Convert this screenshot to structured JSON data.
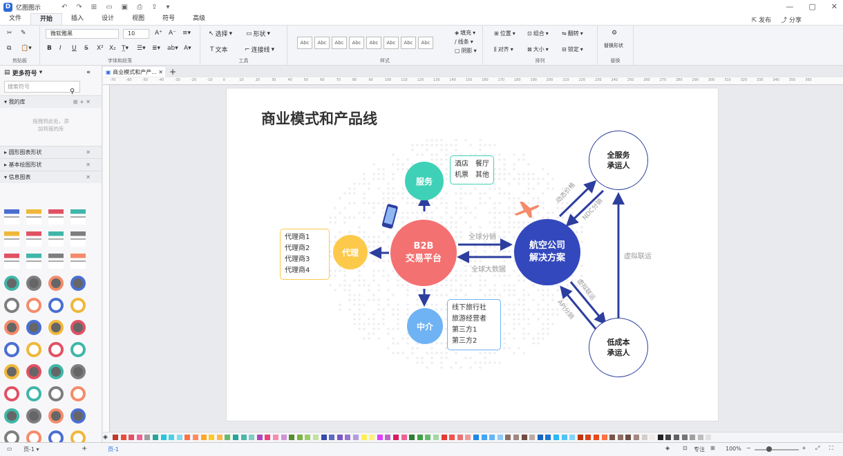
{
  "app": {
    "title": "亿图图示"
  },
  "menu": {
    "tabs": [
      "文件",
      "开始",
      "插入",
      "设计",
      "视图",
      "符号",
      "高级"
    ],
    "active": "开始",
    "publish": "发布",
    "share": "分享"
  },
  "ribbon": {
    "clipboard_label": "剪贴板",
    "font": {
      "name": "微软雅黑",
      "size": "10",
      "label": "字体和段落"
    },
    "tools": {
      "select": "选择",
      "shape": "形状",
      "text": "文本",
      "connector": "连接线",
      "label": "工具"
    },
    "styles": {
      "swatches": [
        "Abc",
        "Abc",
        "Abc",
        "Abc",
        "Abc",
        "Abc",
        "Abc",
        "Abc"
      ],
      "label": "样式",
      "fill": "填充",
      "line": "线条",
      "shadow": "阴影"
    },
    "arrange": {
      "position": "位置",
      "group": "组合",
      "rotate": "翻转",
      "align": "对齐",
      "size": "大小",
      "lock": "锁定",
      "label": "排列"
    },
    "replace": {
      "btn": "替换形状",
      "label": "替换"
    }
  },
  "sidebar": {
    "title": "更多符号",
    "search_placeholder": "搜索符号",
    "my_library": "我的库",
    "library_hint_1": "拖拽到此处，添",
    "library_hint_2": "加到我的库",
    "sections": [
      "圆形图表形状",
      "基本绘图形状",
      "信息图表"
    ]
  },
  "document": {
    "tab": "商业模式和产产..."
  },
  "ruler": {
    "ticks": [
      "-70",
      "-60",
      "-50",
      "-40",
      "-30",
      "-20",
      "-10",
      "0",
      "10",
      "20",
      "30",
      "40",
      "50",
      "60",
      "70",
      "80",
      "90",
      "100",
      "110",
      "120",
      "130",
      "140",
      "150",
      "160",
      "170",
      "180",
      "190",
      "200",
      "210",
      "220",
      "230",
      "240",
      "250",
      "260",
      "270",
      "280",
      "290",
      "300",
      "310",
      "320",
      "330",
      "340",
      "350",
      "360"
    ]
  },
  "diagram": {
    "title": "商业模式和产品线",
    "nodes": {
      "b2b": [
        "B2B",
        "交易平台"
      ],
      "service": "服务",
      "agent": "代理",
      "intermediary": "中介",
      "airline": [
        "航空公司",
        "解决方案"
      ],
      "full_service": [
        "全服务",
        "承运人"
      ],
      "low_cost": [
        "低成本",
        "承运人"
      ]
    },
    "boxes": {
      "service": [
        "酒店　餐厅",
        "机票　其他"
      ],
      "agent": [
        "代理商1",
        "代理商2",
        "代理商3",
        "代理商4"
      ],
      "intermediary": [
        "线下旅行社",
        "旅游经营者",
        "第三方1",
        "第三方2"
      ]
    },
    "labels": {
      "global_distribution": "全球分销",
      "global_bigdata": "全球大数据",
      "dynamic_pricing": "动态价格",
      "ndc": "NDC分销",
      "virtual_interline": "虚拟联运",
      "virtual_interline2": "虚拟联运",
      "api": "API分销"
    },
    "colors": {
      "b2b": "#f47171",
      "service": "#3fd1b7",
      "agent": "#fdc94b",
      "intermediary": "#6fb3f5",
      "airline": "#3348bd",
      "arrow": "#2c3e9e"
    }
  },
  "status": {
    "page_select": "页-1",
    "page_tab": "页-1",
    "focus": "专注",
    "zoom": "100%"
  },
  "palette_colors": [
    "#c0392b",
    "#e74c3c",
    "#e05263",
    "#f06292",
    "#9e9e9e",
    "#26a69a",
    "#26c6da",
    "#4dd0e1",
    "#80deea",
    "#ff7043",
    "#ff8a65",
    "#ffa726",
    "#ffca28",
    "#ffb74d",
    "#66bb6a",
    "#26a69a",
    "#4db6ac",
    "#80cbc4",
    "#ab47bc",
    "#ec407a",
    "#f48fb1",
    "#ce93d8",
    "#558b2f",
    "#7cb342",
    "#9ccc65",
    "#c5e1a5",
    "#3949ab",
    "#5c6bc0",
    "#7e57c2",
    "#9575cd",
    "#b39ddb",
    "#ffee58",
    "#fff176",
    "#e040fb",
    "#ba68c8",
    "#d81b60",
    "#f06292",
    "#2e7d32",
    "#43a047",
    "#66bb6a",
    "#a5d6a7",
    "#e53935",
    "#ef5350",
    "#e57373",
    "#ef9a9a",
    "#1e88e5",
    "#42a5f5",
    "#64b5f6",
    "#90caf9",
    "#8d6e63",
    "#a1887f",
    "#6d4c41",
    "#bcaaa4",
    "#1565c0",
    "#1976d2",
    "#29b6f6",
    "#4fc3f7",
    "#81d4fa",
    "#bf360c",
    "#d84315",
    "#e64a19",
    "#ff7043",
    "#795548",
    "#8d6e63",
    "#6d4c41",
    "#a1887f",
    "#d7ccc8",
    "#efebe9",
    "#212121",
    "#424242",
    "#616161",
    "#757575",
    "#9e9e9e",
    "#bdbdbd",
    "#e0e0e0",
    "#f5f5f5"
  ]
}
